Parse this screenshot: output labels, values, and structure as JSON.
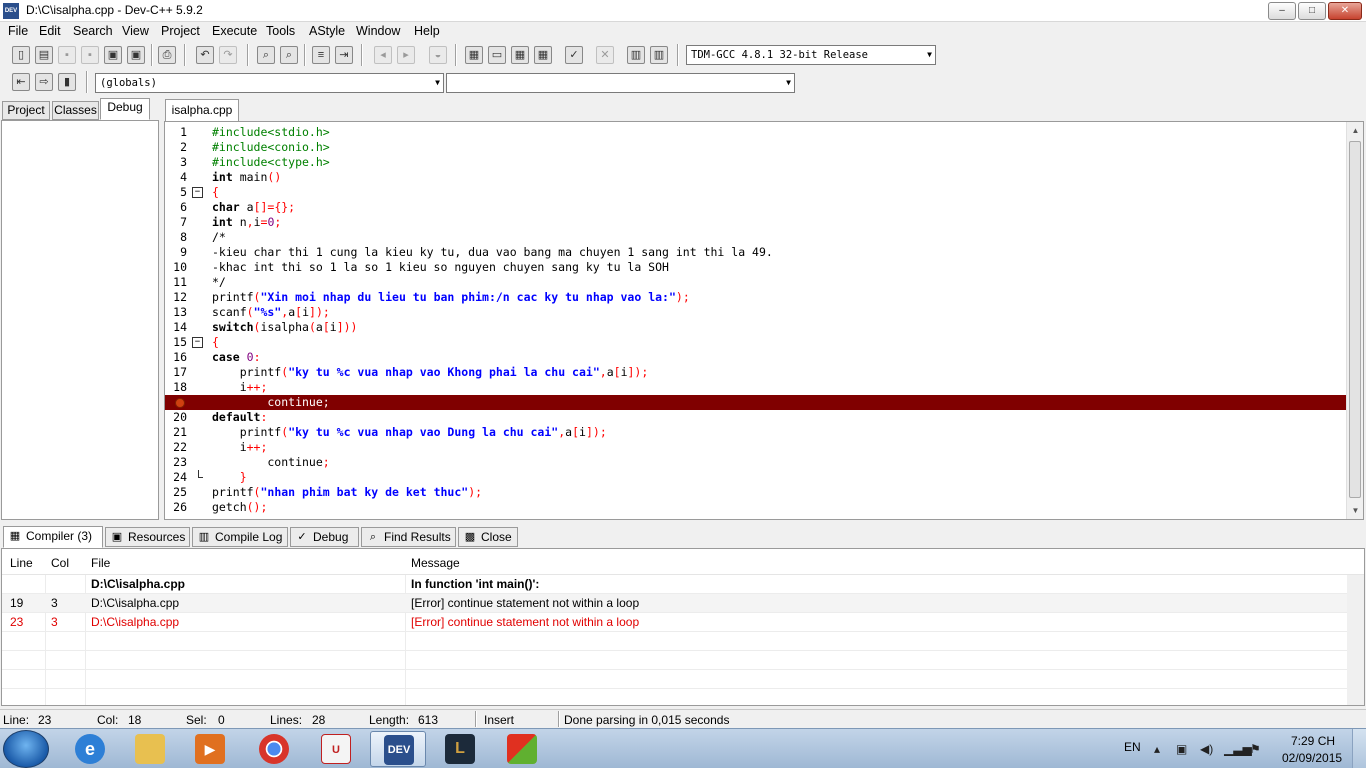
{
  "window": {
    "title": "D:\\C\\isalpha.cpp - Dev-C++ 5.9.2",
    "app_icon_text": "DEV",
    "min_glyph": "–",
    "max_glyph": "□",
    "close_glyph": "✕"
  },
  "menu": {
    "file": "File",
    "edit": "Edit",
    "search": "Search",
    "view": "View",
    "project": "Project",
    "execute": "Execute",
    "tools": "Tools",
    "astyle": "AStyle",
    "window": "Window",
    "help": "Help"
  },
  "toolbar": {
    "compiler_select": "TDM-GCC 4.8.1 32-bit Release",
    "scope_select": "(globals)",
    "function_select": ""
  },
  "left_tabs": {
    "project": "Project",
    "classes": "Classes",
    "debug": "Debug"
  },
  "editor": {
    "tab": "isalpha.cpp",
    "lines": [
      {
        "n": "1",
        "html": "<span class='pp'>#include&lt;stdio.h&gt;</span>"
      },
      {
        "n": "2",
        "html": "<span class='pp'>#include&lt;conio.h&gt;</span>"
      },
      {
        "n": "3",
        "html": "<span class='pp'>#include&lt;ctype.h&gt;</span>"
      },
      {
        "n": "4",
        "html": "<span class='kw'>int</span> main<span class='sym'>()</span>"
      },
      {
        "n": "5",
        "html": "<span class='sym'>{</span>",
        "fold": "open"
      },
      {
        "n": "6",
        "html": "<span class='kw'>char</span> a<span class='sym'>[]={};</span>"
      },
      {
        "n": "7",
        "html": "<span class='kw'>int</span> n<span class='sym'>,</span>i<span class='sym'>=</span><span class='num'>0</span><span class='sym'>;</span>"
      },
      {
        "n": "8",
        "html": "<span class='cm'>/*</span>"
      },
      {
        "n": "9",
        "html": "<span class='cm'>-kieu char thi 1 cung la kieu ky tu, dua vao bang ma chuyen 1 sang int thi la 49.</span>"
      },
      {
        "n": "10",
        "html": "<span class='cm'>-khac int thi so 1 la so 1 kieu so nguyen chuyen sang ky tu la SOH</span>"
      },
      {
        "n": "11",
        "html": "<span class='cm'>*/</span>"
      },
      {
        "n": "12",
        "html": "printf<span class='sym'>(</span><span class='str'>\"Xin moi nhap du lieu tu ban phim:/n cac ky tu nhap vao la:\"</span><span class='sym'>);</span>"
      },
      {
        "n": "13",
        "html": "scanf<span class='sym'>(</span><span class='str'>\"%s\"</span><span class='sym'>,</span>a<span class='sym'>[</span>i<span class='sym'>]);</span>"
      },
      {
        "n": "14",
        "html": "<span class='kw'>switch</span><span class='sym'>(</span>isalpha<span class='sym'>(</span>a<span class='sym'>[</span>i<span class='sym'>]))</span>"
      },
      {
        "n": "15",
        "html": "<span class='sym'>{</span>",
        "fold": "open"
      },
      {
        "n": "16",
        "html": "<span class='kw'>case</span> <span class='num'>0</span><span class='sym'>:</span>"
      },
      {
        "n": "17",
        "html": "    printf<span class='sym'>(</span><span class='str'>\"ky tu %c vua nhap vao Khong phai la chu cai\"</span><span class='sym'>,</span>a<span class='sym'>[</span>i<span class='sym'>]);</span>"
      },
      {
        "n": "18",
        "html": "    i<span class='sym'>++;</span>"
      },
      {
        "n": "19",
        "html": "        continue;",
        "error": true
      },
      {
        "n": "20",
        "html": "<span class='kw'>default</span><span class='sym'>:</span>"
      },
      {
        "n": "21",
        "html": "    printf<span class='sym'>(</span><span class='str'>\"ky tu %c vua nhap vao Dung la chu cai\"</span><span class='sym'>,</span>a<span class='sym'>[</span>i<span class='sym'>]);</span>"
      },
      {
        "n": "22",
        "html": "    i<span class='sym'>++;</span>"
      },
      {
        "n": "23",
        "html": "        continue<span class='sym'>;</span>"
      },
      {
        "n": "24",
        "html": "    <span class='sym'>}</span>",
        "fold": "end"
      },
      {
        "n": "25",
        "html": "printf<span class='sym'>(</span><span class='str'>\"nhan phim bat ky de ket thuc\"</span><span class='sym'>);</span>"
      },
      {
        "n": "26",
        "html": "getch<span class='sym'>();</span>"
      }
    ]
  },
  "bottom_tabs": {
    "compiler": "Compiler (3)",
    "resources": "Resources",
    "compile_log": "Compile Log",
    "debug": "Debug",
    "find_results": "Find Results",
    "close": "Close"
  },
  "messages": {
    "headers": {
      "line": "Line",
      "col": "Col",
      "file": "File",
      "message": "Message"
    },
    "rows": [
      {
        "line": "",
        "col": "",
        "file": "D:\\C\\isalpha.cpp",
        "message": "In function 'int main()':",
        "style": "bold"
      },
      {
        "line": "19",
        "col": "3",
        "file": "D:\\C\\isalpha.cpp",
        "message": "[Error] continue statement not within a loop",
        "style": "alt"
      },
      {
        "line": "23",
        "col": "3",
        "file": "D:\\C\\isalpha.cpp",
        "message": "[Error] continue statement not within a loop",
        "style": "red"
      }
    ]
  },
  "status": {
    "line_label": "Line:",
    "line_value": "23",
    "col_label": "Col:",
    "col_value": "18",
    "sel_label": "Sel:",
    "sel_value": "0",
    "lines_label": "Lines:",
    "lines_value": "28",
    "length_label": "Length:",
    "length_value": "613",
    "mode": "Insert",
    "message": "Done parsing in 0,015 seconds"
  },
  "taskbar": {
    "lang": "EN",
    "time": "7:29 CH",
    "date": "02/09/2015",
    "devcpp_label": "DEV"
  },
  "colors": {
    "error_line_bg": "#800000",
    "error_text": "#e00000",
    "string": "#0000ff",
    "preprocessor": "#008000",
    "symbol": "#ff0000"
  }
}
